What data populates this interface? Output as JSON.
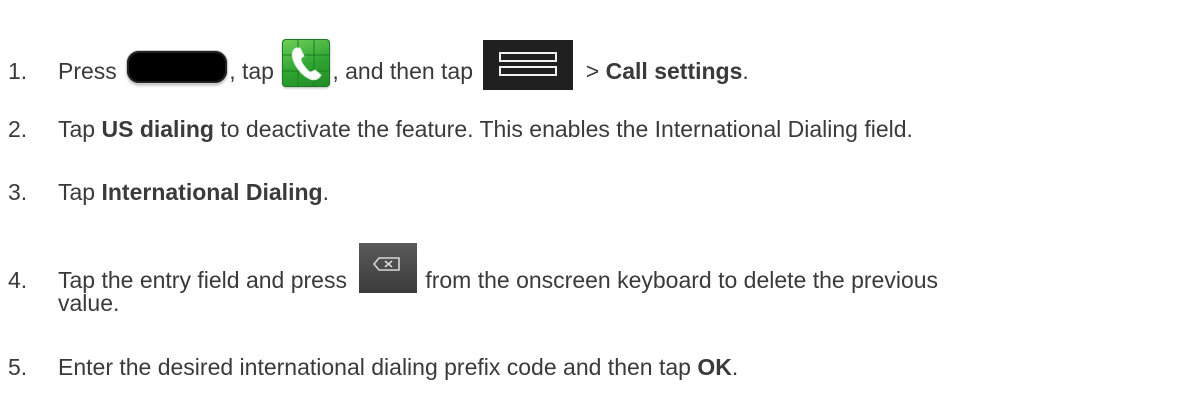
{
  "steps": [
    {
      "number": "1.",
      "press": "Press",
      "tap": ", tap",
      "then_tap": ", and then tap",
      "arrow": " > ",
      "bold": "Call settings",
      "end": "."
    },
    {
      "number": "2.",
      "pre": "Tap ",
      "bold": "US dialing",
      "post": " to deactivate the feature. This enables the International Dialing field."
    },
    {
      "number": "3.",
      "pre": "Tap ",
      "bold": "International Dialing",
      "post": "."
    },
    {
      "number": "4.",
      "pre": "Tap the entry field and press ",
      "post": "from the onscreen keyboard to delete the previous",
      "cont": "value."
    },
    {
      "number": "5.",
      "pre": "Enter the desired international dialing prefix code and then tap ",
      "bold": "OK",
      "post": "."
    }
  ],
  "icons": {
    "home": "home-key-icon",
    "phone": "phone-app-icon",
    "menu": "menu-key-icon",
    "delete": "backspace-key-icon"
  }
}
